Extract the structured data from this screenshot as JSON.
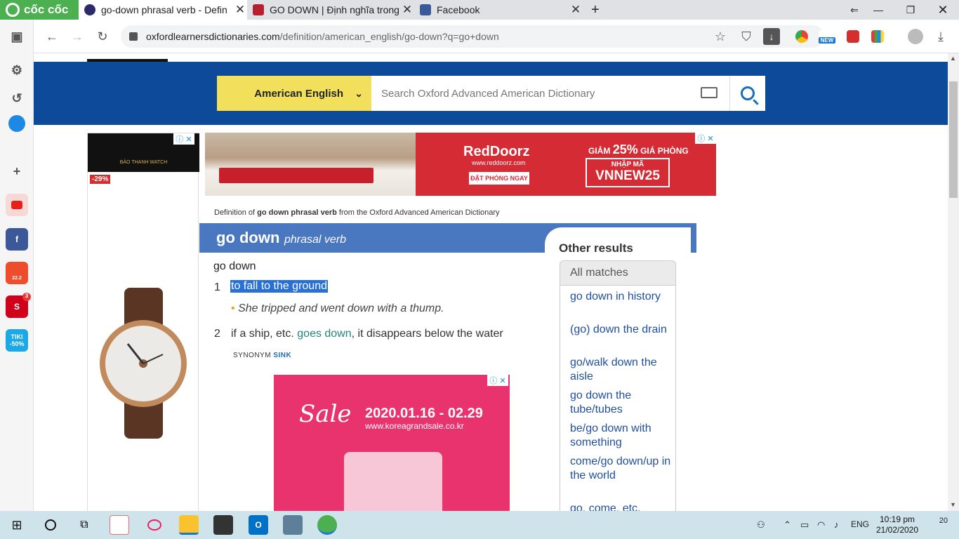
{
  "browser": {
    "brand": "cốc cốc",
    "tabs": [
      {
        "title": "go-down phrasal verb - Defin",
        "active": true
      },
      {
        "title": "GO DOWN | Định nghĩa trong",
        "active": false
      },
      {
        "title": "Facebook",
        "active": false
      }
    ],
    "new_tab": "+",
    "url_host": "oxfordlearnersdictionaries.com",
    "url_path": "/definition/american_english/go-down?q=go+down",
    "extension_badge": "NEW"
  },
  "sidebar": {
    "badges": {
      "shopee": "22.2",
      "sendo_count": "3",
      "tiki": "TIKI -50%"
    }
  },
  "site": {
    "dictionary": "American English",
    "search_placeholder": "Search Oxford Advanced American Dictionary"
  },
  "ads": {
    "left": {
      "brand": "BẢO THANH WATCH",
      "discount": "-29%"
    },
    "top": {
      "brand": "RedDoorz",
      "site": "www.reddoorz.com",
      "cta": "ĐẶT PHÒNG NGAY",
      "promo_prefix": "GIẢM",
      "promo_percent": "25%",
      "promo_suffix": "GIÁ PHÒNG",
      "code_label": "NHẬP MÃ",
      "code": "VNNEW25"
    },
    "mid": {
      "sale": "Sale",
      "dates": "2020.01.16 - 02.29",
      "site": "www.koreagrandsale.co.kr"
    }
  },
  "entry": {
    "breadcrumb_pre": "Definition of ",
    "breadcrumb_bold": "go down phrasal verb",
    "breadcrumb_post": " from the Oxford Advanced American Dictionary",
    "headword": "go down",
    "pos": "phrasal verb",
    "phrase": "go down",
    "senses": [
      {
        "num": "1",
        "def": "to fall to the ground",
        "example": "She tripped and went down with a thump."
      },
      {
        "num": "2",
        "def_pre": "if a ship, etc. ",
        "def_link": "goes down",
        "def_post": ", it disappears below the water"
      }
    ],
    "synonym_label": "SYNONYM",
    "synonym": "SINK"
  },
  "other_results": {
    "title": "Other results",
    "tab": "All matches",
    "items": [
      "go down in history",
      "(go) down the drain",
      "go/walk down the aisle",
      "go down the tube/tubes",
      "be/go down with something",
      "come/go down/up in the world",
      "go, come, etc."
    ]
  },
  "taskbar": {
    "lang": "ENG",
    "time": "10:19 pm",
    "date": "21/02/2020",
    "notifications": "20"
  }
}
